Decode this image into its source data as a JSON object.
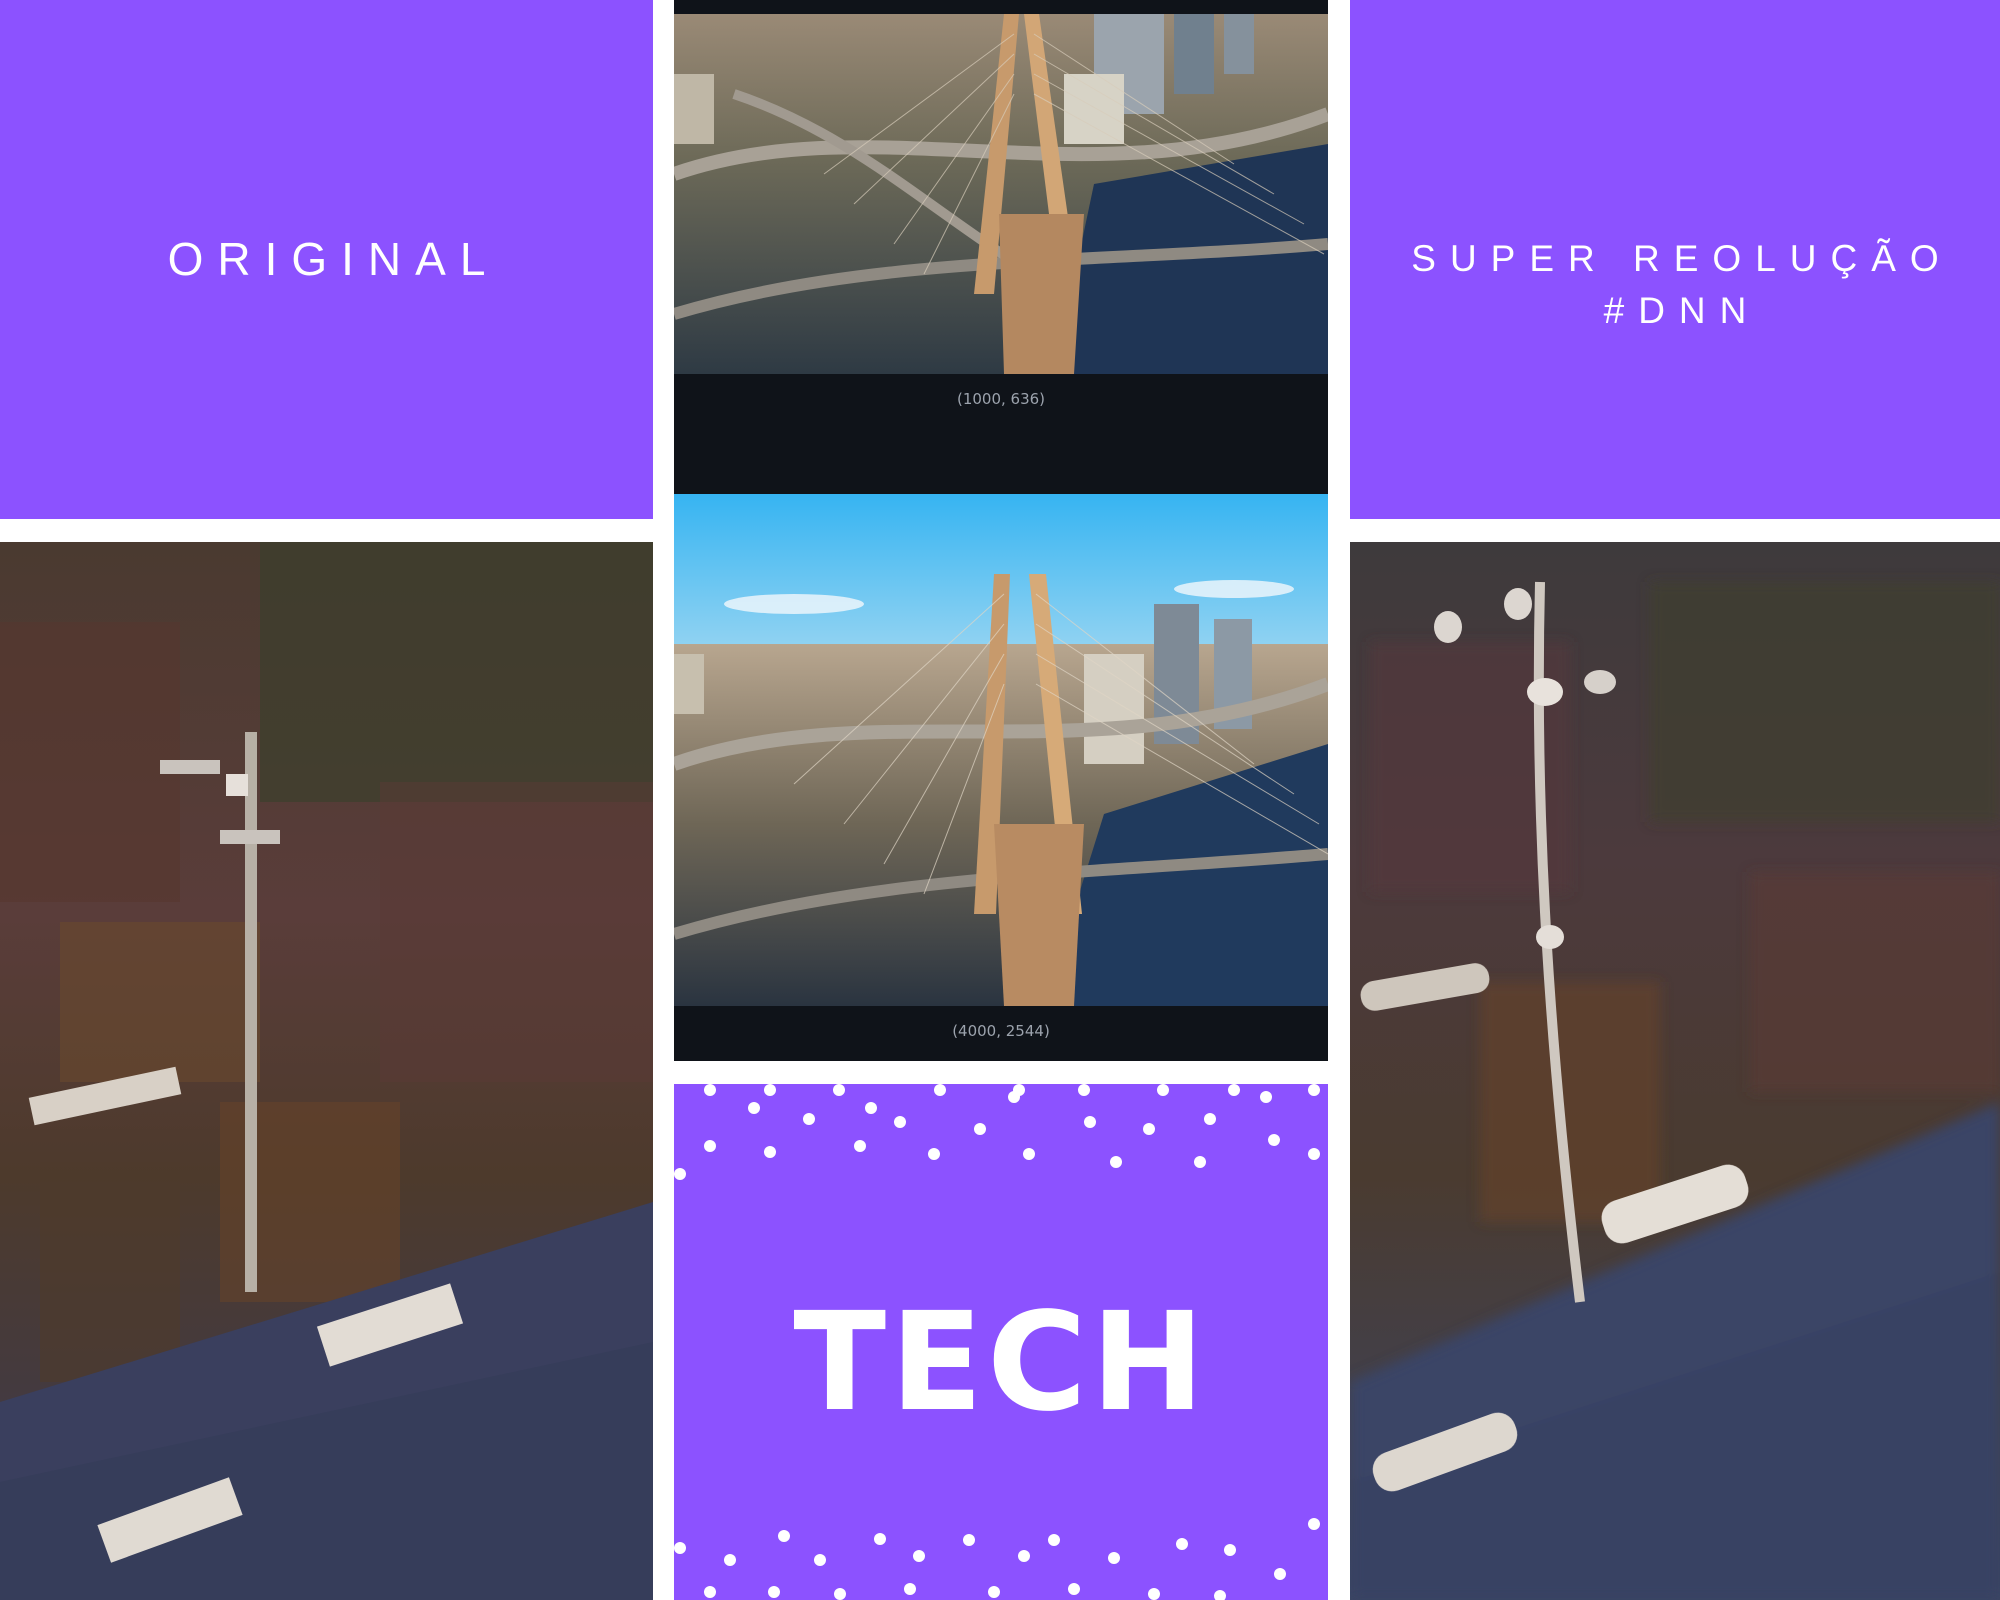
{
  "panels": {
    "original_label": "ORIGINAL",
    "super_label_line1": "SUPER REOLUÇÃO",
    "super_label_line2": "#DNN",
    "tech_label": "TECH"
  },
  "comparison": {
    "top_caption": "(1000, 636)",
    "bottom_caption": "(4000, 2544)"
  },
  "colors": {
    "accent": "#8c52ff",
    "dark_panel": "#0f1319",
    "sky": "#3ab7f2",
    "white": "#ffffff"
  },
  "icons": {
    "bridge_top": "bridge-photo-top",
    "bridge_bottom": "bridge-photo-bottom",
    "zoom_original": "pixelated-zoom-photo",
    "zoom_super": "smoothed-zoom-photo"
  }
}
